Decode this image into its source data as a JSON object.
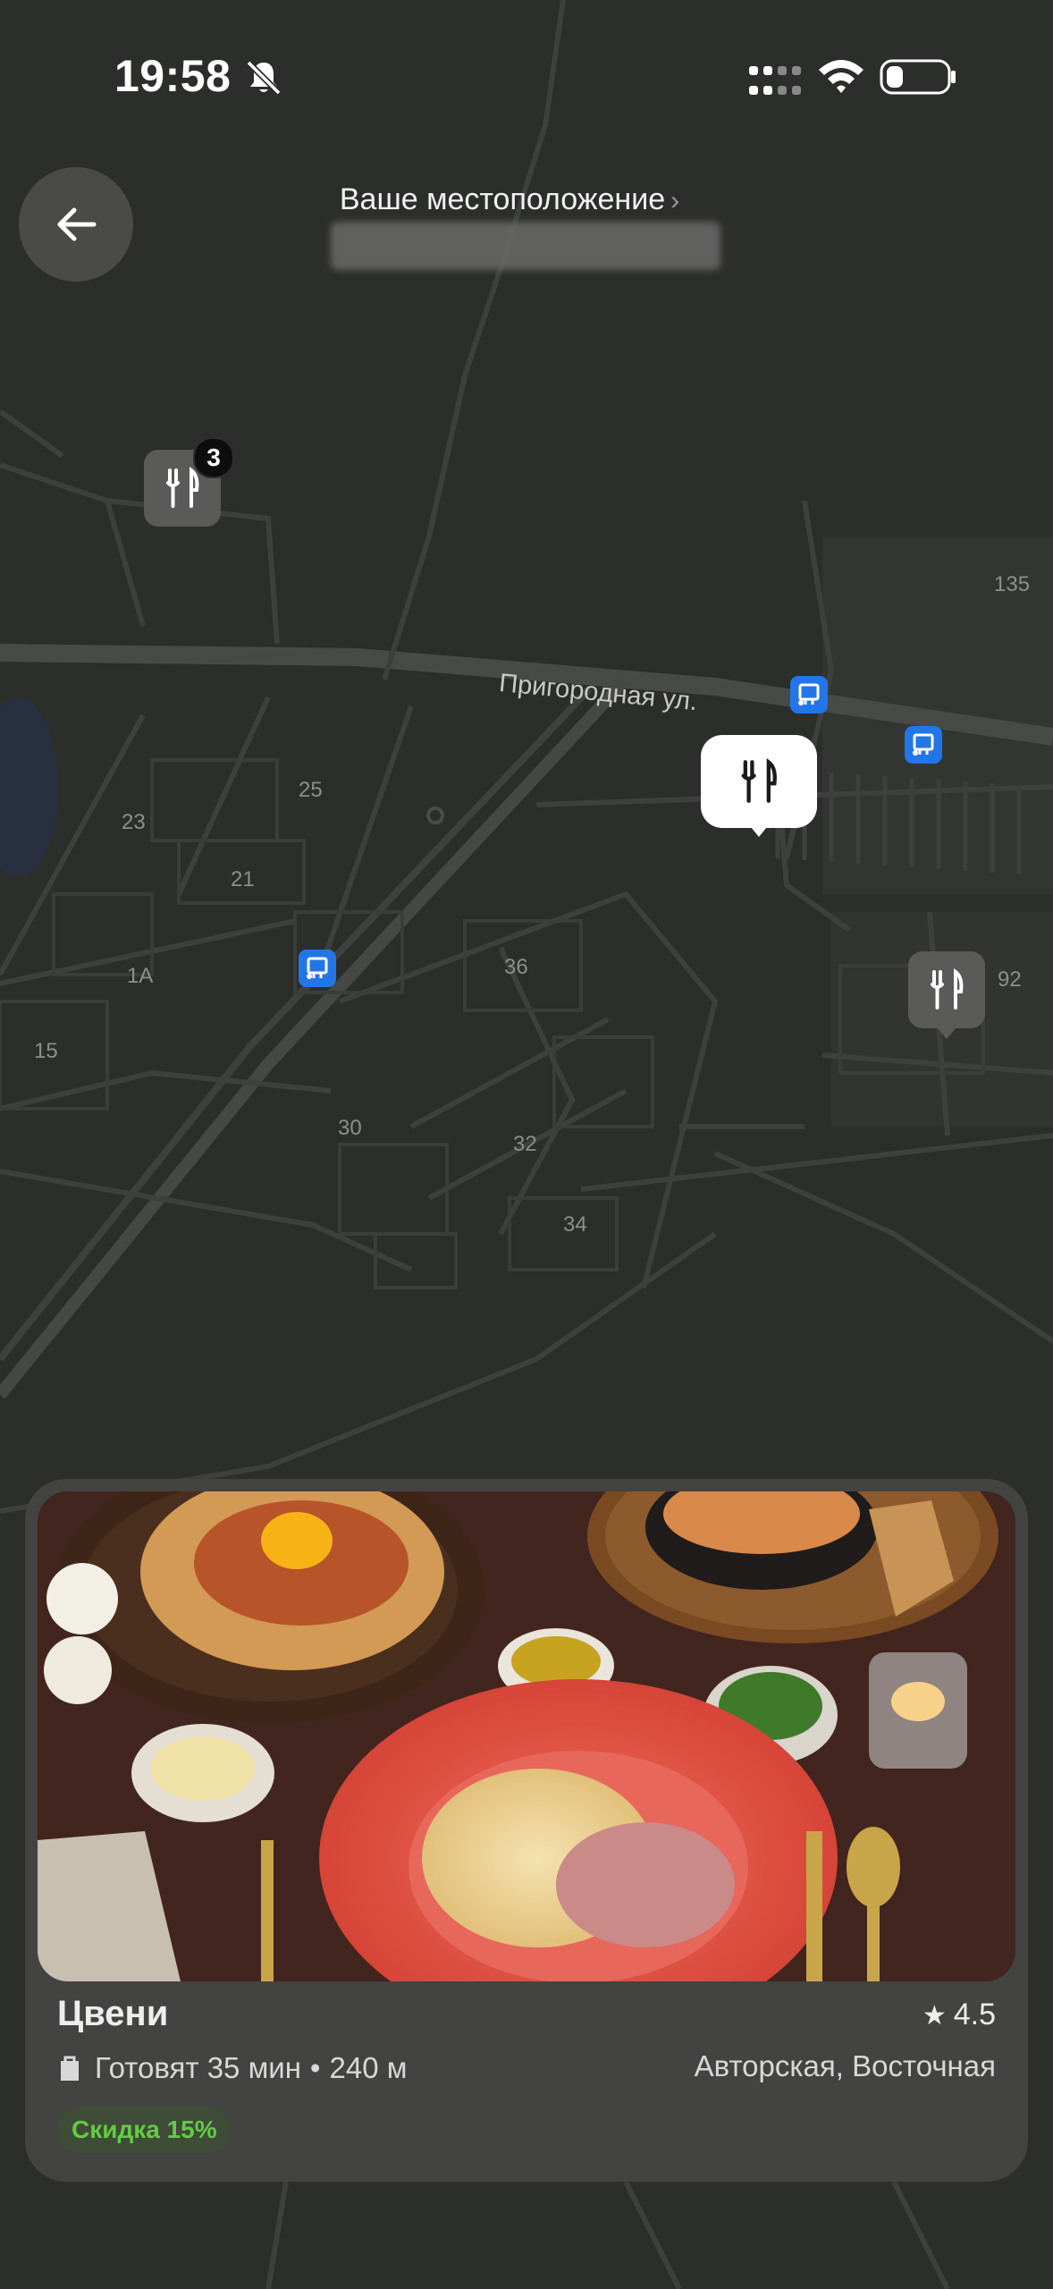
{
  "status_bar": {
    "time": "19:58",
    "icons": [
      "bell-muted-icon",
      "signal-icon",
      "wifi-icon",
      "battery-icon"
    ]
  },
  "header": {
    "back_icon": "arrow-left-icon",
    "title": "Ваше местоположение",
    "title_chevron": "›"
  },
  "map": {
    "street": "Пригородная ул.",
    "house_numbers": [
      "135",
      "25",
      "23",
      "21",
      "1А",
      "36",
      "92",
      "15",
      "30",
      "32",
      "34"
    ],
    "cluster_count": "3",
    "restaurant_pin_icon": "fork-knife-icon",
    "transit_icon": "bus-stop-icon"
  },
  "card": {
    "name": "Цвени",
    "rating": "4.5",
    "rating_icon": "star-icon",
    "cook_time": "Готовят 35 мин",
    "separator": "•",
    "distance": "240 м",
    "cuisine": "Авторская, Восточная",
    "discount": "Скидка 15%",
    "photo": "food-photo"
  },
  "colors": {
    "map_bg": "#2c2e2c",
    "card_bg": "#434341",
    "accent_green": "#62cb44",
    "transit_blue": "#2276e8"
  }
}
